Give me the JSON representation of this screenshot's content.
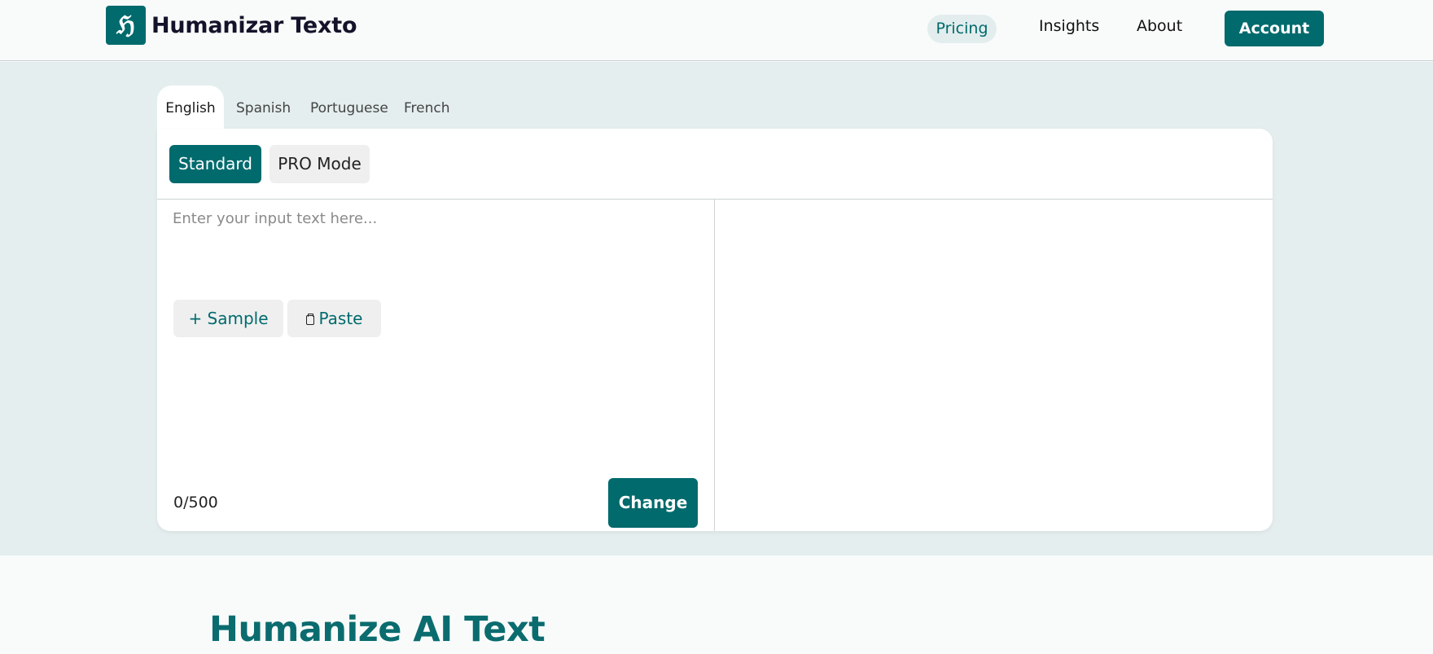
{
  "header": {
    "logo_mark": "ℌ",
    "logo_text": "Humanizar Texto",
    "nav": {
      "pricing": "Pricing",
      "insights": "Insights",
      "about": "About"
    },
    "account_label": "Account"
  },
  "languages": {
    "tabs": [
      "English",
      "Spanish",
      "Portuguese",
      "French"
    ],
    "active": "English"
  },
  "modes": {
    "standard": "Standard",
    "pro": "PRO Mode",
    "active": "Standard"
  },
  "input": {
    "value": "",
    "placeholder": "Enter your input text here...",
    "sample_label": "+ Sample",
    "paste_label": "Paste",
    "counter": "0/500",
    "change_label": "Change"
  },
  "output": {
    "value": ""
  },
  "section": {
    "title": "Humanize AI Text"
  },
  "colors": {
    "brand": "#006a6d",
    "band_background": "#e5eeee",
    "page_background": "#f9fbfb"
  },
  "icons": [
    "logo-mark-icon",
    "clipboard-icon"
  ]
}
